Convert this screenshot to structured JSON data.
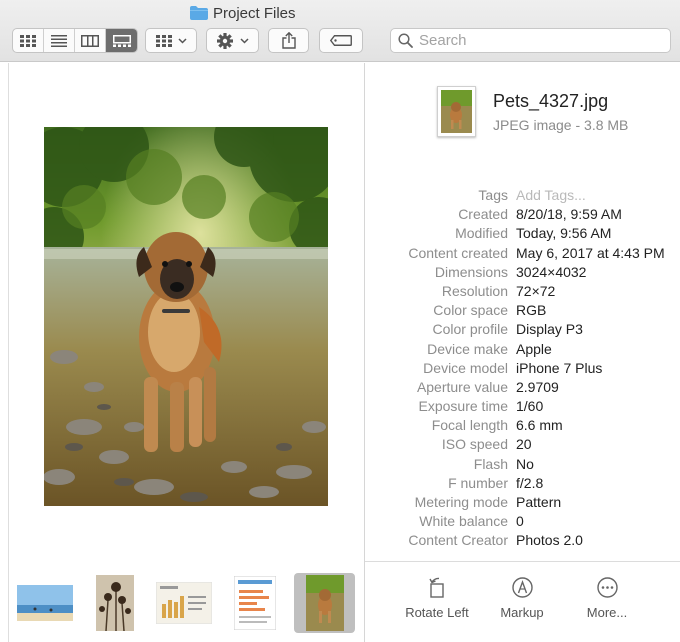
{
  "window": {
    "title": "Project Files"
  },
  "toolbar": {
    "view_modes": [
      {
        "name": "icon-view",
        "active": false
      },
      {
        "name": "list-view",
        "active": false
      },
      {
        "name": "column-view",
        "active": false
      },
      {
        "name": "gallery-view",
        "active": true
      }
    ],
    "search": {
      "placeholder": "Search",
      "value": ""
    }
  },
  "file": {
    "name": "Pets_4327.jpg",
    "kind": "JPEG image - 3.8 MB"
  },
  "metadata": [
    {
      "key": "Tags",
      "value": "Add Tags..."
    },
    {
      "key": "Created",
      "value": "8/20/18, 9:59 AM"
    },
    {
      "key": "Modified",
      "value": "Today, 9:56 AM"
    },
    {
      "key": "Content created",
      "value": "May 6, 2017 at 4:43 PM"
    },
    {
      "key": "Dimensions",
      "value": "3024×4032"
    },
    {
      "key": "Resolution",
      "value": "72×72"
    },
    {
      "key": "Color space",
      "value": "RGB"
    },
    {
      "key": "Color profile",
      "value": "Display P3"
    },
    {
      "key": "Device make",
      "value": "Apple"
    },
    {
      "key": "Device model",
      "value": "iPhone 7 Plus"
    },
    {
      "key": "Aperture value",
      "value": "2.9709"
    },
    {
      "key": "Exposure time",
      "value": "1/60"
    },
    {
      "key": "Focal length",
      "value": "6.6 mm"
    },
    {
      "key": "ISO speed",
      "value": "20"
    },
    {
      "key": "Flash",
      "value": "No"
    },
    {
      "key": "F number",
      "value": "f/2.8"
    },
    {
      "key": "Metering mode",
      "value": "Pattern"
    },
    {
      "key": "White balance",
      "value": "0"
    },
    {
      "key": "Content Creator",
      "value": "Photos 2.0"
    }
  ],
  "actions": {
    "rotate_left": "Rotate Left",
    "markup": "Markup",
    "more": "More..."
  },
  "colors": {
    "accent_folder": "#5aa9e6",
    "selected_thumb": "#bfbfbf",
    "active_segment": "#6d6d6d"
  }
}
